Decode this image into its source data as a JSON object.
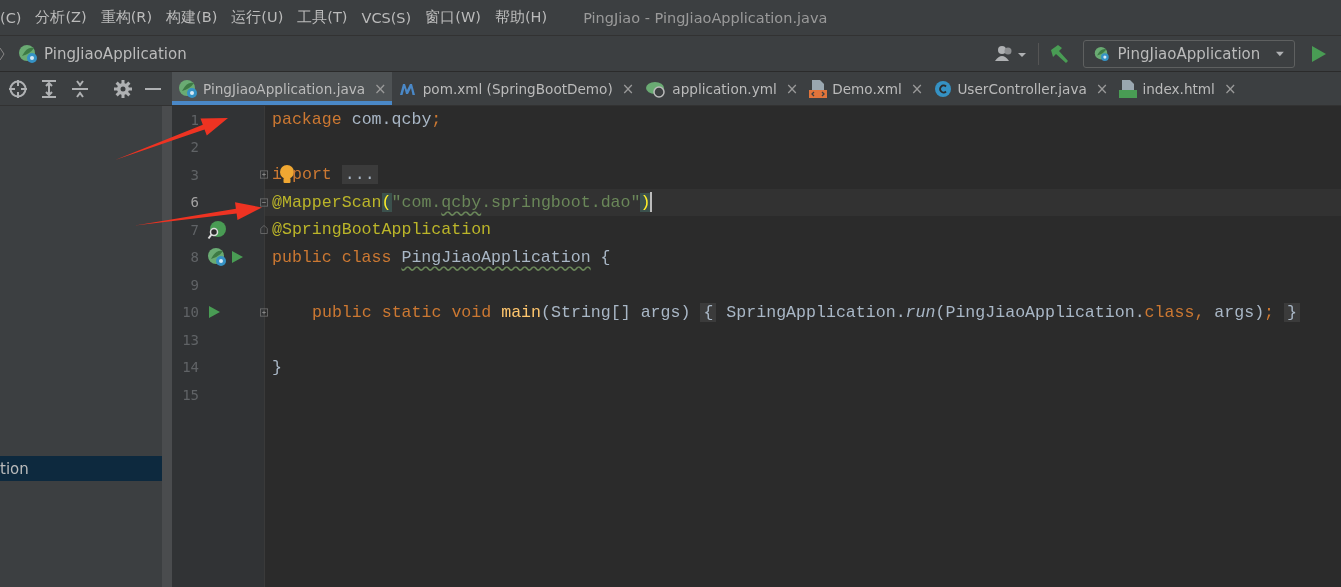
{
  "menu_bar": {
    "items": [
      "(C)",
      "分析(Z)",
      "重构(R)",
      "构建(B)",
      "运行(U)",
      "工具(T)",
      "VCS(S)",
      "窗口(W)",
      "帮助(H)"
    ],
    "title": "PingJiao - PingJiaoApplication.java"
  },
  "nav_bar": {
    "breadcrumb": "PingJiaoApplication",
    "run_config": "PingJiaoApplication"
  },
  "tabs": [
    {
      "label": "PingJiaoApplication.java",
      "kind": "spring",
      "close": "×",
      "selected": true
    },
    {
      "label": "pom.xml (SpringBootDemo)",
      "kind": "maven",
      "close": "×",
      "selected": false
    },
    {
      "label": "application.yml",
      "kind": "spring-config",
      "close": "×",
      "selected": false
    },
    {
      "label": "Demo.xml",
      "kind": "xml",
      "close": "×",
      "selected": false
    },
    {
      "label": "UserController.java",
      "kind": "class",
      "close": "×",
      "selected": false
    },
    {
      "label": "index.html",
      "kind": "html",
      "close": "×",
      "selected": false
    }
  ],
  "project_tree": {
    "items": [
      {
        "label": "tion",
        "selected": true
      }
    ]
  },
  "editor": {
    "lines": [
      {
        "number": "1",
        "arrow": true,
        "tokens": [
          {
            "kind": "kw",
            "t": "package"
          },
          {
            "kind": "plain",
            "t": " com.qcby"
          },
          {
            "kind": "kw",
            "t": ";"
          }
        ]
      },
      {
        "number": "2"
      },
      {
        "number": "3",
        "fold": {
          "kind": "plus"
        },
        "tokens": [
          {
            "kind": "kw",
            "t": "i"
          },
          {
            "kind": "bulb"
          },
          {
            "kind": "kw",
            "t": "port"
          },
          {
            "kind": "folded",
            "t": "..."
          }
        ]
      },
      {
        "number": "6",
        "current": true,
        "caret": true,
        "arrow": true,
        "fold": {
          "kind": "minus"
        },
        "tokens": [
          {
            "kind": "ann",
            "t": "@MapperScan"
          },
          {
            "kind": "match",
            "t": "("
          },
          {
            "kind": "str",
            "t": "\"com."
          },
          {
            "kind": "str",
            "t": "qcby",
            "typo": true
          },
          {
            "kind": "str",
            "t": ".springboot.dao\""
          },
          {
            "kind": "match",
            "t": ")"
          }
        ]
      },
      {
        "number": "7",
        "markers": [
          {
            "kind": "bean-search"
          }
        ],
        "fold": {
          "kind": "end"
        },
        "tokens": [
          {
            "kind": "ann",
            "t": "@SpringBootApplication"
          }
        ]
      },
      {
        "number": "8",
        "markers": [
          {
            "kind": "bean"
          },
          {
            "kind": "run"
          }
        ],
        "tokens": [
          {
            "kind": "kw",
            "t": "public class "
          },
          {
            "kind": "plain",
            "t": "PingJiaoApplication",
            "typo": true
          },
          {
            "kind": "plain",
            "t": " {"
          }
        ]
      },
      {
        "number": "9"
      },
      {
        "number": "10",
        "indented": true,
        "markers": [
          {
            "kind": "run"
          }
        ],
        "fold": {
          "kind": "plus"
        },
        "tokens": [
          {
            "kind": "kw",
            "t": "public static void "
          },
          {
            "kind": "method",
            "t": "main"
          },
          {
            "kind": "plain",
            "t": "(String[] args)"
          },
          {
            "kind": "folded",
            "t": "{"
          },
          {
            "kind": "plain",
            "t": " SpringApplication."
          },
          {
            "kind": "italic",
            "t": "run"
          },
          {
            "kind": "plain",
            "t": "(PingJiaoApplication."
          },
          {
            "kind": "kw",
            "t": "class, "
          },
          {
            "kind": "plain",
            "t": "args)"
          },
          {
            "kind": "kw",
            "t": ";"
          },
          {
            "kind": "folded",
            "t": "}"
          }
        ]
      },
      {
        "number": "13"
      },
      {
        "number": "14",
        "tokens": [
          {
            "kind": "plain",
            "t": "}"
          }
        ]
      },
      {
        "number": "15"
      }
    ]
  }
}
